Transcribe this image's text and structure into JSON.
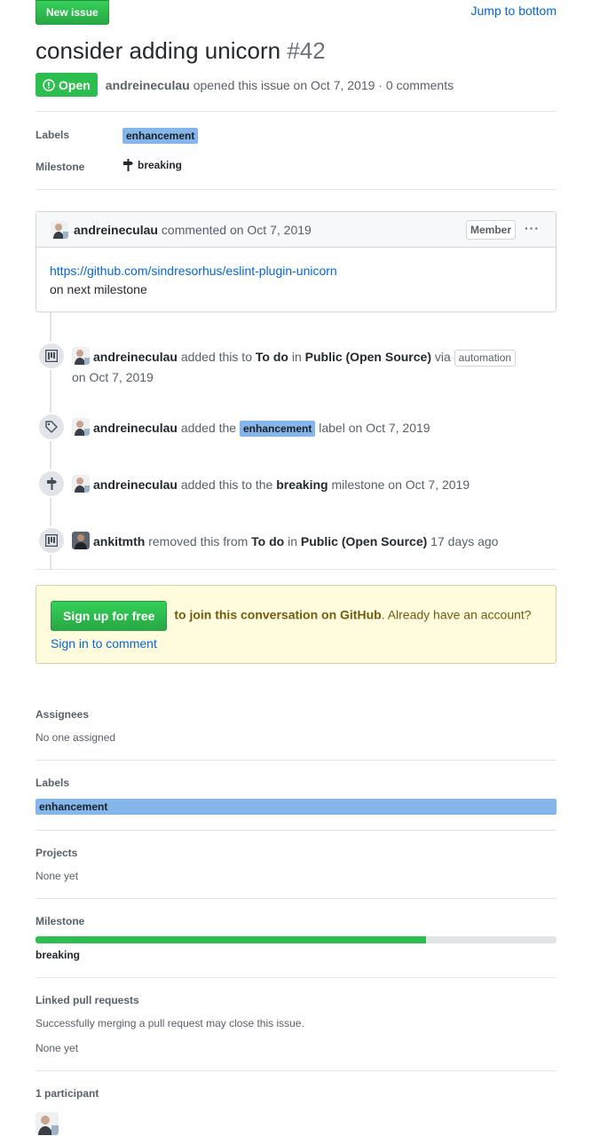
{
  "header": {
    "new_issue_label": "New issue",
    "jump_label": "Jump to bottom"
  },
  "issue": {
    "title": "consider adding unicorn",
    "number": "#42",
    "state": "Open",
    "author": "andreineculau",
    "opened_text": "opened this issue on Oct 7, 2019 · 0 comments"
  },
  "summary": {
    "labels_title": "Labels",
    "label": "enhancement",
    "milestone_title": "Milestone",
    "milestone": "breaking"
  },
  "comment": {
    "author": "andreineculau",
    "date_text": "commented on Oct 7, 2019",
    "badge": "Member",
    "menu": "···",
    "link": "https://github.com/sindresorhus/eslint-plugin-unicorn",
    "text": "on next milestone"
  },
  "timeline": [
    {
      "icon": "project-icon",
      "actor": "andreineculau",
      "t1": "added this to",
      "target": "To do",
      "t2": "in",
      "project": "Public (Open Source)",
      "t3": "via",
      "via": "automation",
      "date": "on Oct 7, 2019"
    },
    {
      "icon": "tag-icon",
      "actor": "andreineculau",
      "t1": "added the",
      "label": "enhancement",
      "t2": "label on Oct 7, 2019"
    },
    {
      "icon": "milestone-icon",
      "actor": "andreineculau",
      "t1": "added this to the",
      "milestone": "breaking",
      "t2": "milestone on Oct 7, 2019"
    },
    {
      "icon": "project-icon",
      "actor": "ankitmth",
      "t1": "removed this from",
      "target": "To do",
      "t2": "in",
      "project": "Public (Open Source)",
      "date": "17 days ago"
    }
  ],
  "signup": {
    "button": "Sign up for free",
    "text": "to join this conversation on GitHub",
    "after": ". Already have an account?",
    "signin": "Sign in to comment"
  },
  "sidebar": {
    "assignees_title": "Assignees",
    "assignees_value": "No one assigned",
    "labels_title": "Labels",
    "label": "enhancement",
    "projects_title": "Projects",
    "projects_value": "None yet",
    "milestone_title": "Milestone",
    "milestone_progress": 0.75,
    "milestone_value": "breaking",
    "linked_title": "Linked pull requests",
    "linked_desc": "Successfully merging a pull request may close this issue.",
    "linked_value": "None yet",
    "participants_title": "1 participant"
  },
  "colors": {
    "accent": "#0366d6",
    "open": "#2cbe4e",
    "label": "#84b6eb",
    "signup_bg": "#fffbdd"
  }
}
